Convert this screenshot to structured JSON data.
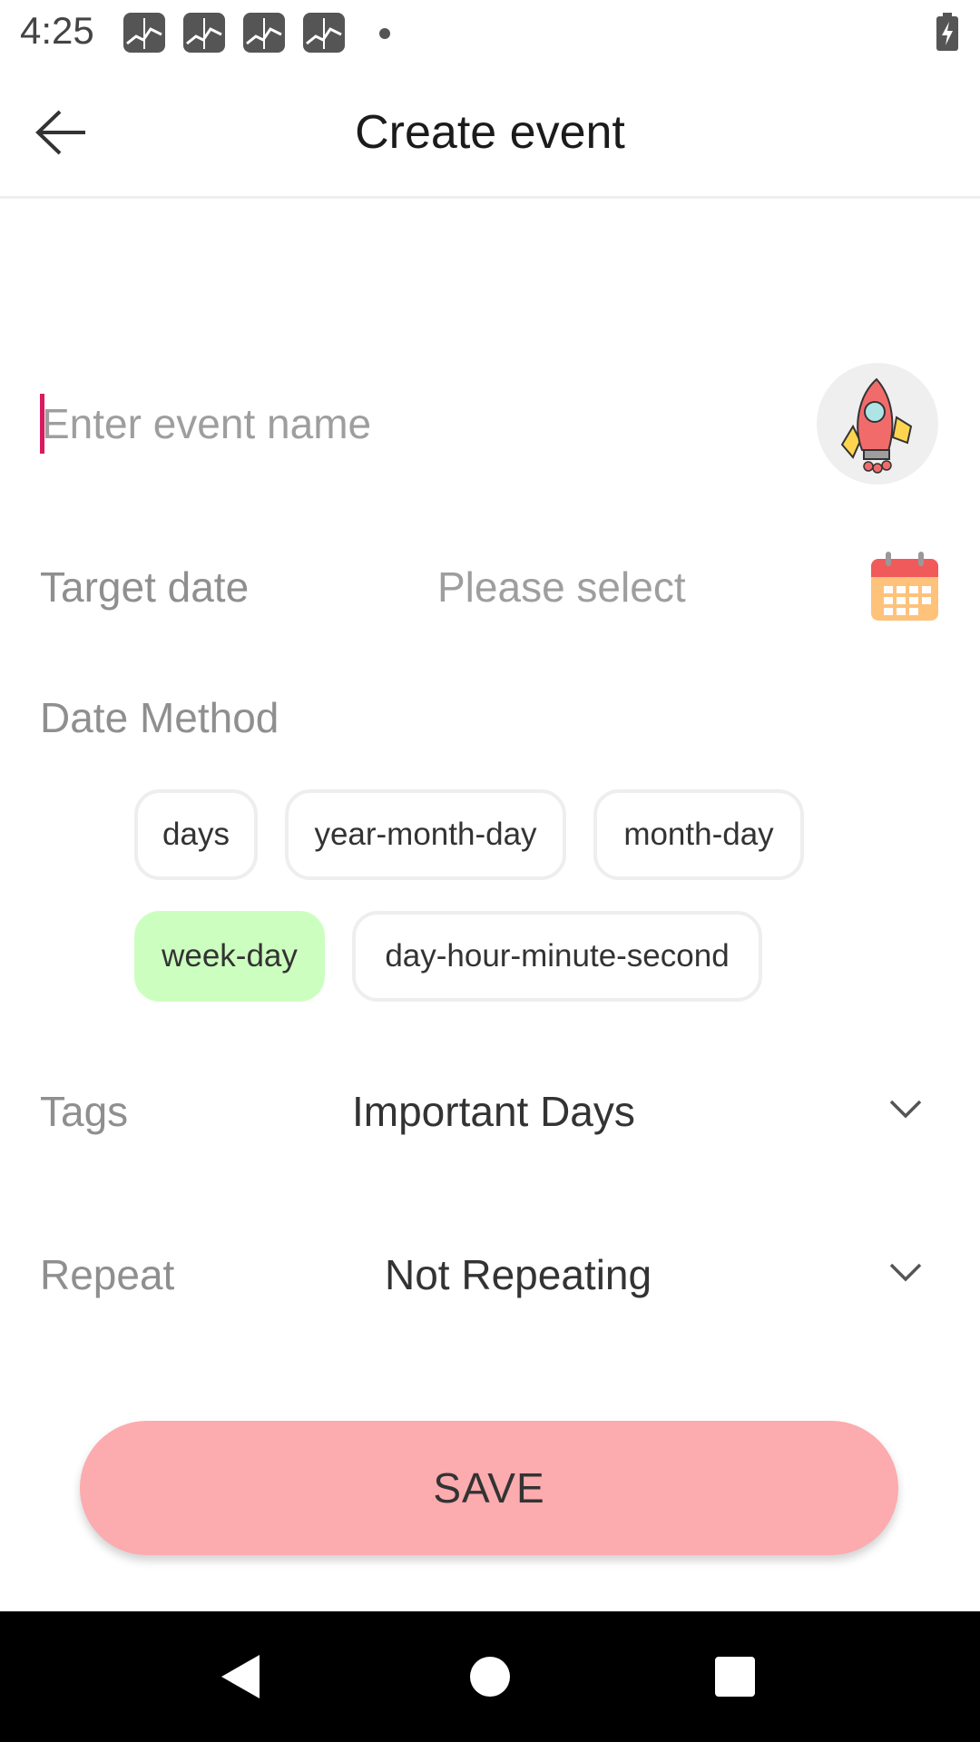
{
  "status_bar": {
    "time": "4:25",
    "notification_icons": [
      "chart-app-icon",
      "chart-app-icon",
      "chart-app-icon",
      "chart-app-icon"
    ],
    "battery": "battery-charging-icon"
  },
  "app_bar": {
    "title": "Create event",
    "back_icon": "arrow-left-icon"
  },
  "form": {
    "event_name": {
      "value": "",
      "placeholder": "Enter event name"
    },
    "event_icon": "rocket-icon",
    "target_date": {
      "label": "Target date",
      "value": "Please select",
      "icon": "calendar-icon"
    },
    "date_method": {
      "label": "Date Method",
      "options": [
        "days",
        "year-month-day",
        "month-day",
        "week-day",
        "day-hour-minute-second"
      ],
      "selected": "week-day"
    },
    "tags": {
      "label": "Tags",
      "value": "Important Days"
    },
    "repeat": {
      "label": "Repeat",
      "value": "Not Repeating"
    }
  },
  "save_label": "SAVE",
  "nav_bar": {
    "buttons": [
      "back-triangle-icon",
      "home-circle-icon",
      "recents-square-icon"
    ]
  },
  "colors": {
    "accent_caret": "#d81b60",
    "selected_chip": "#ccffbf",
    "save_button": "#fcabae",
    "calendar_red": "#f05a5a",
    "calendar_orange": "#ffc27a"
  }
}
